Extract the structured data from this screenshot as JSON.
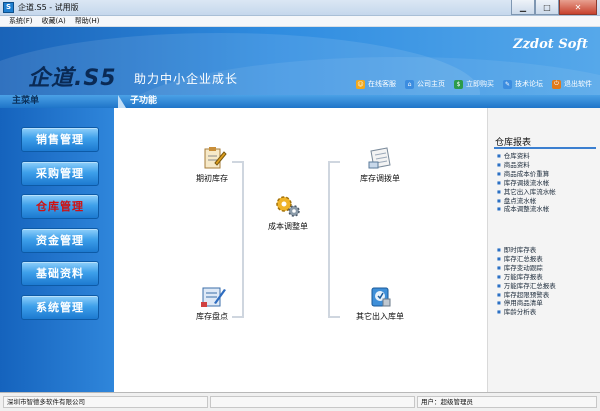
{
  "window": {
    "title": "企道.S5 - 试用版",
    "app_icon": "S"
  },
  "menubar": {
    "items": [
      "系统(F)",
      "收藏(A)",
      "帮助(H)"
    ]
  },
  "header": {
    "brand": "Zzdot Soft",
    "logo": "企道.S5",
    "slogan": "助力中小企业成长",
    "links": [
      {
        "label": "在线客服",
        "icon": "support-icon",
        "color": "#f2a81c"
      },
      {
        "label": "公司主页",
        "icon": "home-icon",
        "color": "#3c8de0"
      },
      {
        "label": "立即购买",
        "icon": "cart-icon",
        "color": "#2c9b4b"
      },
      {
        "label": "技术论坛",
        "icon": "forum-icon",
        "color": "#3c8de0"
      },
      {
        "label": "退出软件",
        "icon": "exit-icon",
        "color": "#e07a1c"
      }
    ]
  },
  "sections": {
    "main_menu": "主菜单",
    "sub_function": "子功能"
  },
  "sidebar": {
    "items": [
      {
        "label": "销售管理",
        "active": false
      },
      {
        "label": "采购管理",
        "active": false
      },
      {
        "label": "仓库管理",
        "active": true
      },
      {
        "label": "资金管理",
        "active": false
      },
      {
        "label": "基础资料",
        "active": false
      },
      {
        "label": "系统管理",
        "active": false
      }
    ]
  },
  "main": {
    "nodes": {
      "opening_stock": "期初库存",
      "stocktaking": "库存盘点",
      "cost_adjust": "成本调整单",
      "transfer": "库存调拨单",
      "other_io": "其它出入库单"
    }
  },
  "reports": {
    "title": "仓库报表",
    "group1": [
      "仓库资料",
      "商品资料",
      "商品成本价重算",
      "库存调拨流水帐",
      "其它出入库流水帐",
      "盘点流水帐",
      "成本调整流水帐"
    ],
    "group2": [
      "即时库存表",
      "库存汇总报表",
      "库存变动跟踪",
      "万能库存报表",
      "万能库存汇总报表",
      "库存超限预警表",
      "停用商品清单",
      "库龄分析表"
    ]
  },
  "status": {
    "company": "深圳市智德多软件有限公司",
    "user": "用户：超级管理员"
  }
}
